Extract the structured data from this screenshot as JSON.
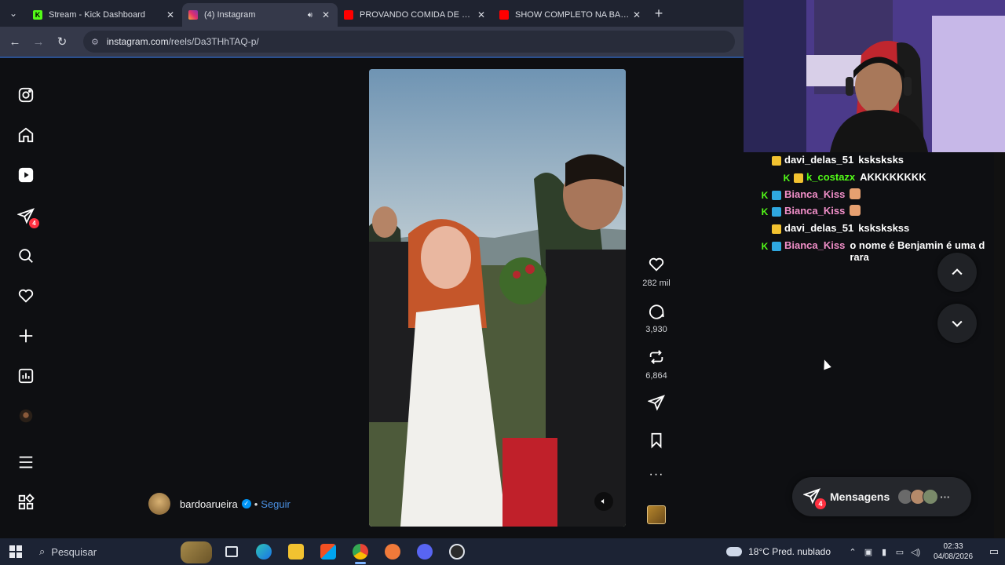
{
  "browser": {
    "tabs": [
      {
        "title": "Stream - Kick Dashboard",
        "favicon": "kick-icon",
        "color": "#53fc18",
        "active": false
      },
      {
        "title": "(4) Instagram",
        "favicon": "instagram-icon",
        "color": "#e1306c",
        "active": true
      },
      {
        "title": "PROVANDO COMIDA DE RUA E",
        "favicon": "youtube-icon",
        "color": "#ff0000",
        "active": false
      },
      {
        "title": "SHOW COMPLETO NA BARRA (",
        "favicon": "youtube-icon",
        "color": "#ff0000",
        "active": false
      }
    ],
    "url_host": "instagram.com",
    "url_path": "/reels/Da3THhTAQ-p/"
  },
  "instagram": {
    "sidebar_badge": "4",
    "author": {
      "name": "bardoarueira",
      "follow_label": "Seguir",
      "separator": "•"
    },
    "actions": {
      "likes": "282 mil",
      "comments": "3,930",
      "reposts": "6,864"
    },
    "messages": {
      "label": "Mensagens",
      "badge": "4",
      "more": "···"
    }
  },
  "chat": {
    "messages": [
      {
        "user": "davi_delas_51",
        "color": "#ffffff",
        "badges": [
          "crown"
        ],
        "text": "ksksksks"
      },
      {
        "user": "k_costazx",
        "color": "#53fc18",
        "badges": [
          "k",
          "crown"
        ],
        "text": "AKKKKKKKK"
      },
      {
        "user": "Bianca_Kiss",
        "color": "#f28fc9",
        "badges": [
          "k",
          "vip"
        ],
        "text": "",
        "emote": true
      },
      {
        "user": "Bianca_Kiss",
        "color": "#f28fc9",
        "badges": [
          "k",
          "vip"
        ],
        "text": "",
        "emote": true
      },
      {
        "user": "davi_delas_51",
        "color": "#ffffff",
        "badges": [
          "crown"
        ],
        "text": "kskskskss"
      },
      {
        "user": "Bianca_Kiss",
        "color": "#f28fc9",
        "badges": [
          "k",
          "vip"
        ],
        "text": "o nome é Benjamin é uma d",
        "text2": "rara"
      }
    ]
  },
  "taskbar": {
    "search_placeholder": "Pesquisar",
    "weather": "18°C  Pred. nublado",
    "time": "02:33",
    "date": "04/08/2026"
  }
}
